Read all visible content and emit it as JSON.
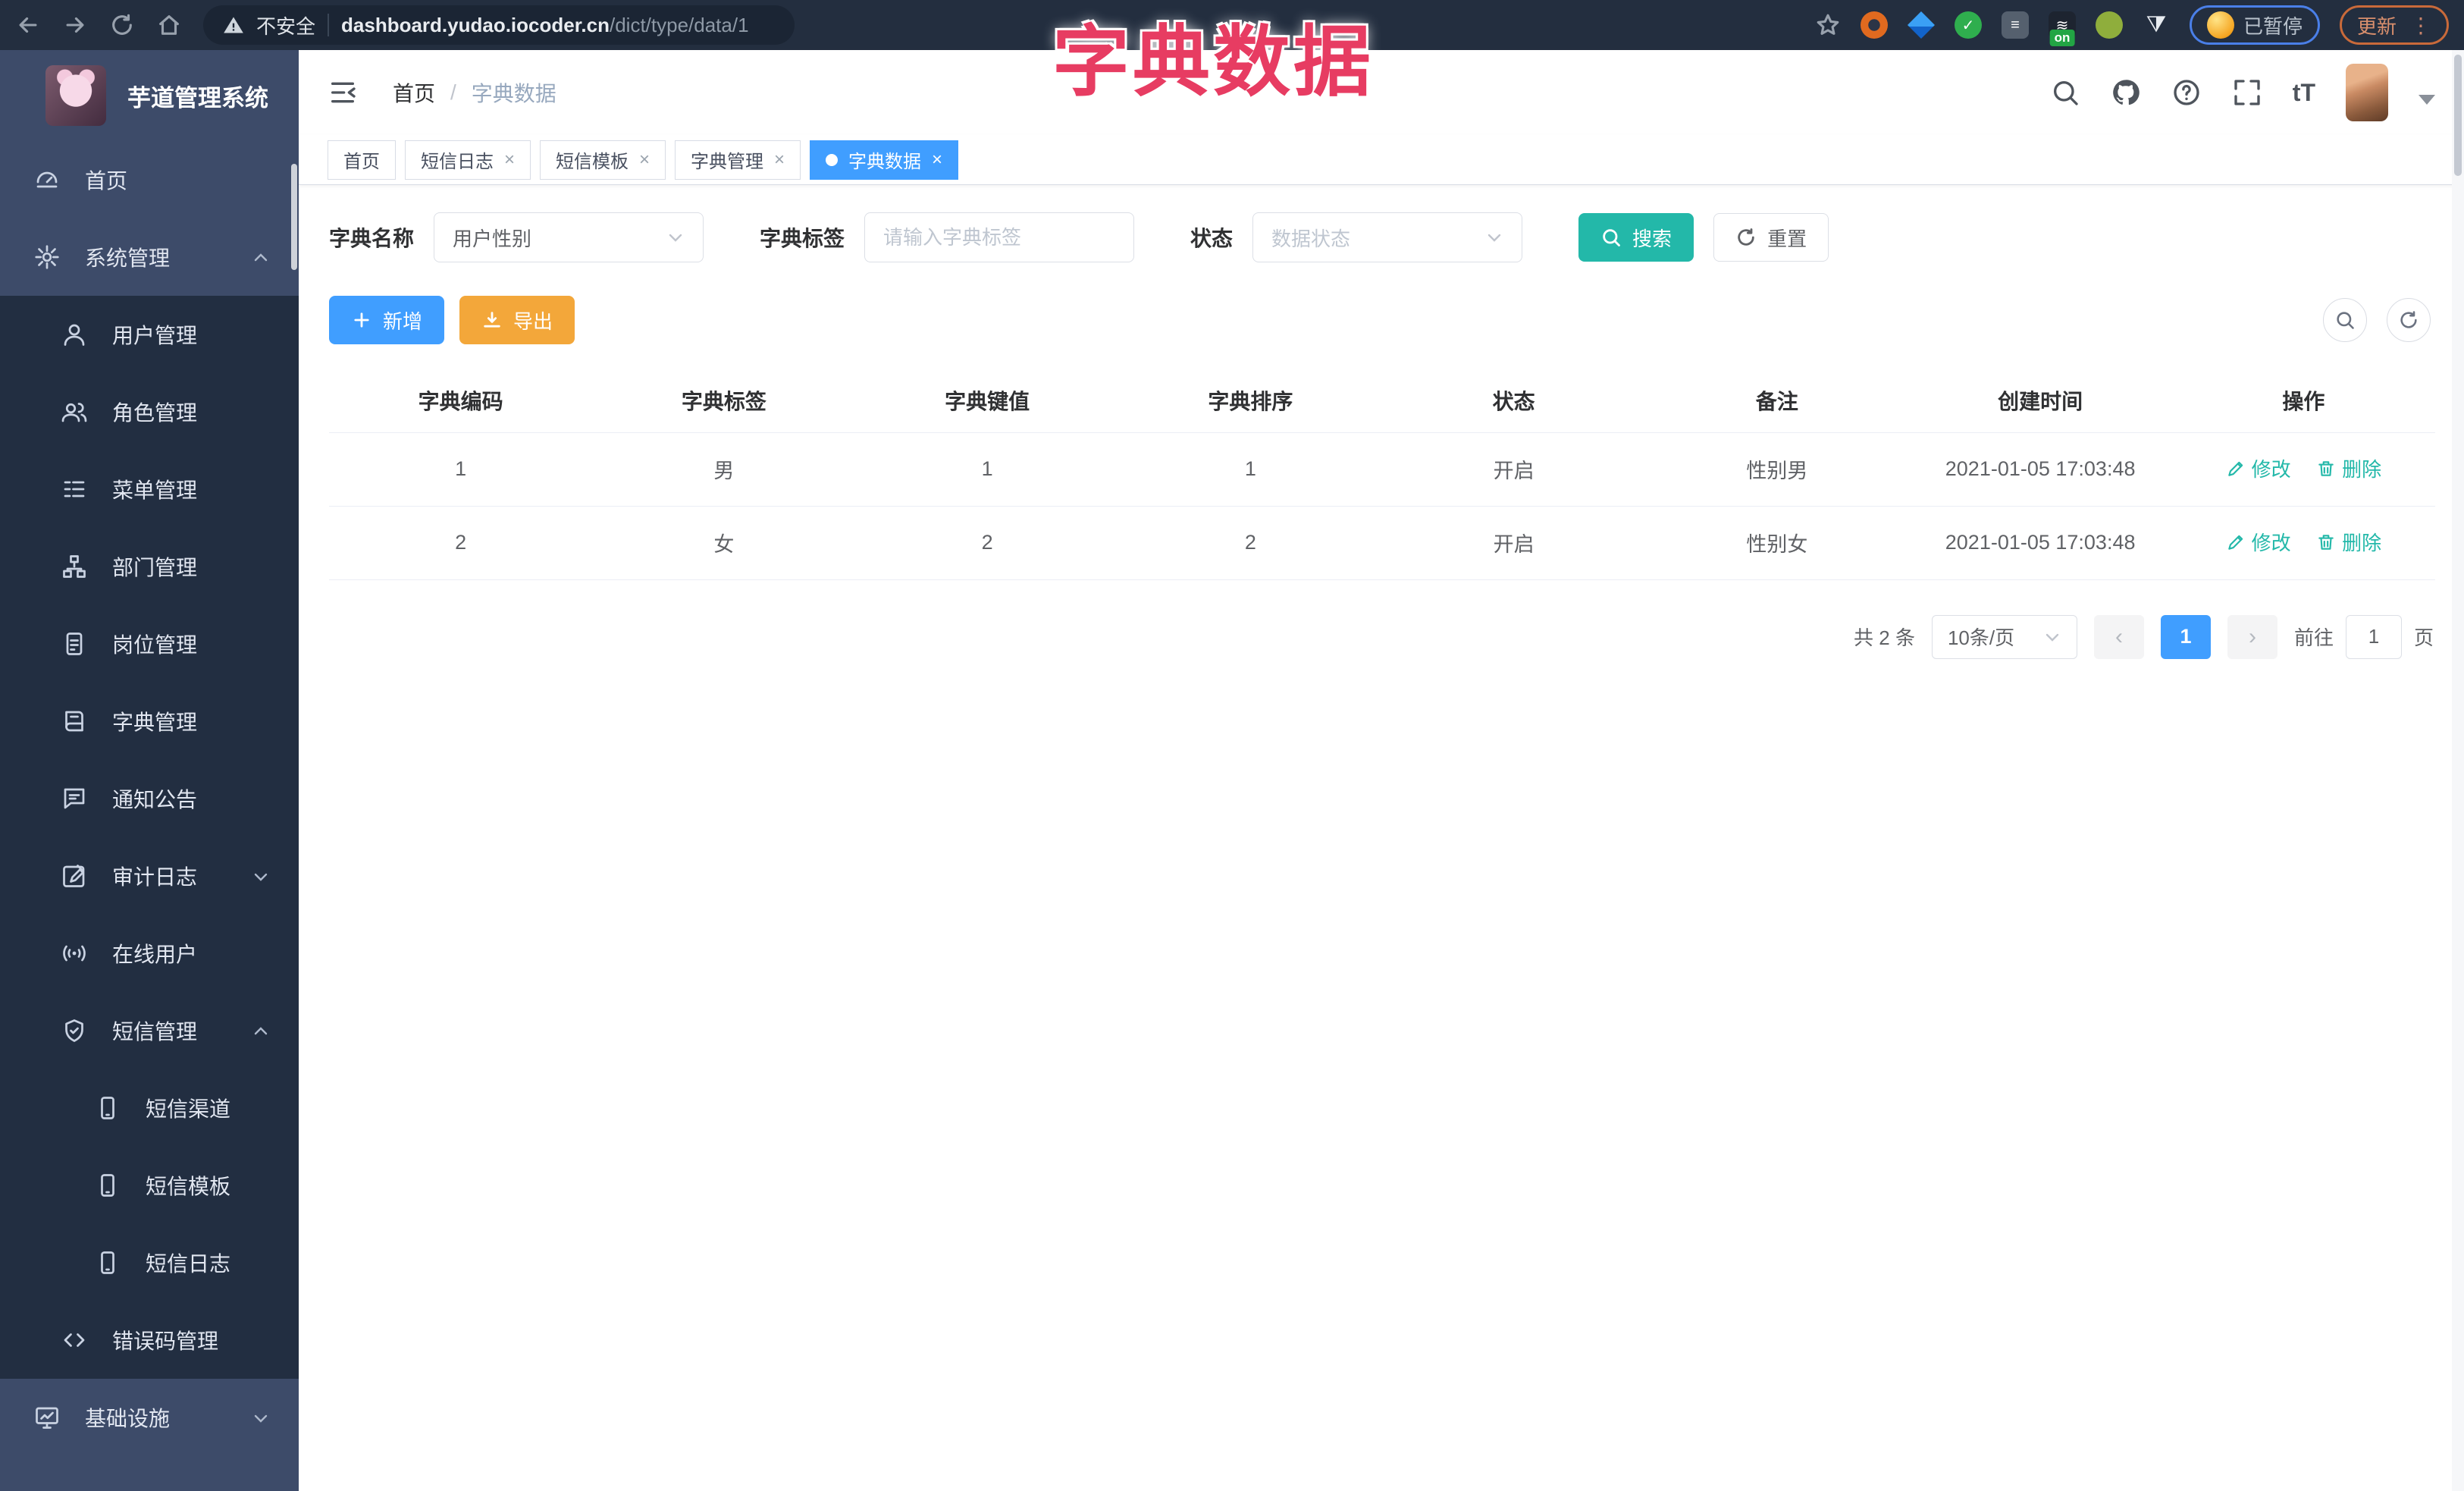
{
  "browser": {
    "security_label": "不安全",
    "url_host": "dashboard.yudao.iocoder.cn",
    "url_path": "/dict/type/data/1",
    "ext_on_badge": "on",
    "paused_label": "已暂停",
    "update_label": "更新",
    "kebab_glyph": "⋮"
  },
  "overlay_title": "字典数据",
  "sidebar": {
    "app_title": "芋道管理系统",
    "items": [
      {
        "label": "首页"
      },
      {
        "label": "系统管理"
      },
      {
        "label": "用户管理"
      },
      {
        "label": "角色管理"
      },
      {
        "label": "菜单管理"
      },
      {
        "label": "部门管理"
      },
      {
        "label": "岗位管理"
      },
      {
        "label": "字典管理"
      },
      {
        "label": "通知公告"
      },
      {
        "label": "审计日志"
      },
      {
        "label": "在线用户"
      },
      {
        "label": "短信管理"
      },
      {
        "label": "短信渠道"
      },
      {
        "label": "短信模板"
      },
      {
        "label": "短信日志"
      },
      {
        "label": "错误码管理"
      },
      {
        "label": "基础设施"
      }
    ]
  },
  "navbar": {
    "breadcrumb_home": "首页",
    "breadcrumb_sep": "/",
    "breadcrumb_current": "字典数据",
    "font_size_glyph": "tT"
  },
  "tabs": [
    {
      "label": "首页"
    },
    {
      "label": "短信日志"
    },
    {
      "label": "短信模板"
    },
    {
      "label": "字典管理"
    },
    {
      "label": "字典数据"
    }
  ],
  "close_glyph": "×",
  "filters": {
    "name_label": "字典名称",
    "name_value": "用户性别",
    "tag_label": "字典标签",
    "tag_placeholder": "请输入字典标签",
    "status_label": "状态",
    "status_placeholder": "数据状态",
    "search_label": "搜索",
    "reset_label": "重置"
  },
  "toolbar": {
    "add_label": "新增",
    "export_label": "导出"
  },
  "table": {
    "columns": [
      "字典编码",
      "字典标签",
      "字典键值",
      "字典排序",
      "状态",
      "备注",
      "创建时间",
      "操作"
    ],
    "rows": [
      {
        "code": "1",
        "label": "男",
        "value": "1",
        "sort": "1",
        "status": "开启",
        "remark": "性别男",
        "created_at": "2021-01-05 17:03:48"
      },
      {
        "code": "2",
        "label": "女",
        "value": "2",
        "sort": "2",
        "status": "开启",
        "remark": "性别女",
        "created_at": "2021-01-05 17:03:48"
      }
    ],
    "edit_label": "修改",
    "delete_label": "删除"
  },
  "pagination": {
    "total_text": "共 2 条",
    "page_size_value": "10条/页",
    "prev_glyph": "‹",
    "current_page": "1",
    "next_glyph": "›",
    "goto_label": "前往",
    "goto_value": "1",
    "page_unit": "页"
  },
  "colors": {
    "accent_blue": "#409eff",
    "teal": "#23b8a9",
    "warning_orange": "#f3a73a",
    "overlay_pink": "#e73c62",
    "sidebar_bg": "#3d4b69",
    "submenu_bg": "#222e41"
  }
}
